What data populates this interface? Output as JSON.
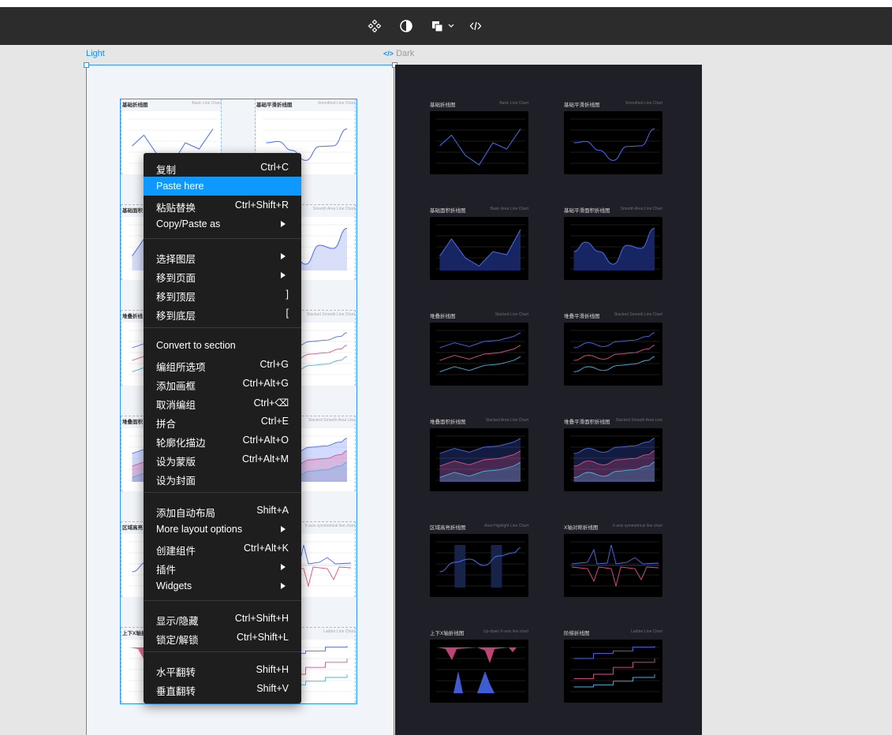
{
  "toolbar": {
    "icons": [
      "component-icon",
      "contrast-icon",
      "shapes-icon",
      "code-icon"
    ]
  },
  "canvas": {
    "light_label": "Light",
    "dark_label": "Dark",
    "dark_code_glyph": "</>"
  },
  "charts": [
    {
      "title": "基础折线图",
      "subtitle": "Basic Line Chart"
    },
    {
      "title": "基础平滑折线图",
      "subtitle": "Smoothed Line Chart"
    },
    {
      "title": "基础面积折线图",
      "subtitle": "Basic Area Line Chart"
    },
    {
      "title": "基础平滑面积折线图",
      "subtitle": "Smooth Area Line Chart"
    },
    {
      "title": "堆叠折线图",
      "subtitle": "Stacked Line Chart"
    },
    {
      "title": "堆叠平滑折线图",
      "subtitle": "Stacked Smooth Line Chart"
    },
    {
      "title": "堆叠面积折线图",
      "subtitle": "Stacked Area Line Chart"
    },
    {
      "title": "堆叠平滑面积折线图",
      "subtitle": "Stacked Smooth Area Line"
    },
    {
      "title": "区域高亮折线图",
      "subtitle": "Area Highlight Line Chart"
    },
    {
      "title": "X轴对称折线图",
      "subtitle": "X-axis symmetrical line chart"
    },
    {
      "title": "上下X轴折线图",
      "subtitle": "Up-down X-axis line chart"
    },
    {
      "title": "阶梯折线图",
      "subtitle": "Ladder Line Chart"
    }
  ],
  "light_titles_visible": [
    "基础折线图",
    "基础平滑折线图",
    "基础面积",
    "Smooth Area Line Chart",
    "堆叠折线",
    "Stacked Smooth Line Chart",
    "堆叠面积",
    "Stacked Smooth Area Line",
    "区域高亮",
    "X-axis symmetrical line chart",
    "上下X轴折",
    "Ladder Line Chart"
  ],
  "context_menu": {
    "groups": [
      [
        {
          "label": "复制",
          "shortcut": "Ctrl+C",
          "submenu": false
        },
        {
          "label": "Paste here",
          "shortcut": "",
          "submenu": false,
          "active": true
        },
        {
          "label": "粘贴替换",
          "shortcut": "Ctrl+Shift+R",
          "submenu": false
        },
        {
          "label": "Copy/Paste as",
          "shortcut": "",
          "submenu": true
        }
      ],
      [
        {
          "label": "选择图层",
          "shortcut": "",
          "submenu": true
        },
        {
          "label": "移到页面",
          "shortcut": "",
          "submenu": true
        },
        {
          "label": "移到顶层",
          "shortcut": "]",
          "submenu": false
        },
        {
          "label": "移到底层",
          "shortcut": "[",
          "submenu": false
        }
      ],
      [
        {
          "label": "Convert to section",
          "shortcut": "",
          "submenu": false
        },
        {
          "label": "编组所选项",
          "shortcut": "Ctrl+G",
          "submenu": false
        },
        {
          "label": "添加画框",
          "shortcut": "Ctrl+Alt+G",
          "submenu": false
        },
        {
          "label": "取消编组",
          "shortcut": "Ctrl+⌫",
          "submenu": false
        },
        {
          "label": "拼合",
          "shortcut": "Ctrl+E",
          "submenu": false
        },
        {
          "label": "轮廓化描边",
          "shortcut": "Ctrl+Alt+O",
          "submenu": false
        },
        {
          "label": "设为蒙版",
          "shortcut": "Ctrl+Alt+M",
          "submenu": false
        },
        {
          "label": "设为封面",
          "shortcut": "",
          "submenu": false
        }
      ],
      [
        {
          "label": "添加自动布局",
          "shortcut": "Shift+A",
          "submenu": false
        },
        {
          "label": "More layout options",
          "shortcut": "",
          "submenu": true
        },
        {
          "label": "创建组件",
          "shortcut": "Ctrl+Alt+K",
          "submenu": false
        },
        {
          "label": "插件",
          "shortcut": "",
          "submenu": true
        },
        {
          "label": "Widgets",
          "shortcut": "",
          "submenu": true
        }
      ],
      [
        {
          "label": "显示/隐藏",
          "shortcut": "Ctrl+Shift+H",
          "submenu": false
        },
        {
          "label": "锁定/解锁",
          "shortcut": "Ctrl+Shift+L",
          "submenu": false
        }
      ],
      [
        {
          "label": "水平翻转",
          "shortcut": "Shift+H",
          "submenu": false
        },
        {
          "label": "垂直翻转",
          "shortcut": "Shift+V",
          "submenu": false
        }
      ]
    ]
  },
  "colors": {
    "toolbar_bg": "#2c2c2c",
    "selection": "#2d96f0",
    "menu_bg": "#1e1e1e",
    "menu_active": "#0d99ff",
    "dark_frame_bg": "#1f1f28",
    "series_blue": "#4a6cf7",
    "series_pink": "#e0508a",
    "series_cyan": "#47b4e6"
  }
}
